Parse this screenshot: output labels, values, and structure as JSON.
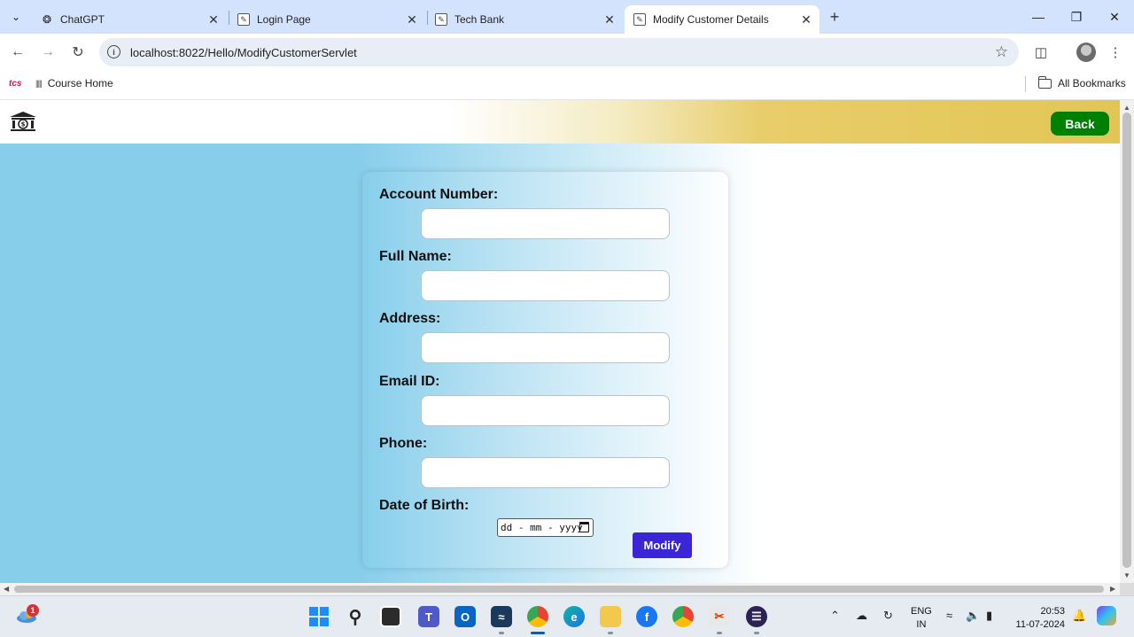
{
  "browser": {
    "tabs": [
      {
        "title": "ChatGPT",
        "icon": "chatgpt-icon",
        "active": false
      },
      {
        "title": "Login Page",
        "icon": "page-icon",
        "active": false
      },
      {
        "title": "Tech Bank",
        "icon": "page-icon",
        "active": false
      },
      {
        "title": "Modify Customer Details",
        "icon": "page-icon",
        "active": true
      }
    ],
    "url": "localhost:8022/Hello/ModifyCustomerServlet",
    "bookmarks": {
      "tcs_label": "tcs",
      "course_home": "Course Home",
      "all_bookmarks": "All Bookmarks"
    }
  },
  "page": {
    "back_label": "Back",
    "form": {
      "fields": [
        {
          "label": "Account Number:",
          "value": ""
        },
        {
          "label": "Full Name:",
          "value": ""
        },
        {
          "label": "Address:",
          "value": ""
        },
        {
          "label": "Email ID:",
          "value": ""
        },
        {
          "label": "Phone:",
          "value": ""
        }
      ],
      "dob_label": "Date of Birth:",
      "dob_placeholder": "dd - mm - yyyy",
      "submit_label": "Modify"
    },
    "colors": {
      "back_button": "#008000",
      "modify_button": "#3b25d6",
      "body_left": "#87ceeb",
      "header_gold": "#e2c655"
    }
  },
  "taskbar": {
    "weather_badge": "1",
    "language": [
      "ENG",
      "IN"
    ],
    "time": "20:53",
    "date": "11-07-2024"
  }
}
